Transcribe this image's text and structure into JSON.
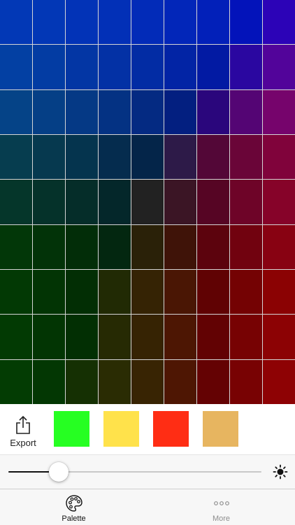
{
  "palette": {
    "rows": [
      [
        "#0238b6",
        "#0237b6",
        "#0233b7",
        "#0230b7",
        "#022bb8",
        "#0226b9",
        "#0220b9",
        "#0313ba",
        "#2c03b7"
      ],
      [
        "#0340a3",
        "#033ca3",
        "#0336a4",
        "#0331a5",
        "#022ca4",
        "#0224a5",
        "#021aa3",
        "#2a07a0",
        "#52049a"
      ],
      [
        "#054387",
        "#053f86",
        "#053985",
        "#043283",
        "#042a82",
        "#031f80",
        "#2a067c",
        "#540574",
        "#76046c"
      ],
      [
        "#063d4f",
        "#06394f",
        "#05344e",
        "#052c4e",
        "#042549",
        "#2d1a48",
        "#530737",
        "#6a0538",
        "#80033b"
      ],
      [
        "#05362a",
        "#05322a",
        "#052d29",
        "#04272a",
        "#222222",
        "#3b1525",
        "#560524",
        "#6e0428",
        "#860329"
      ],
      [
        "#023708",
        "#023308",
        "#022d08",
        "#032710",
        "#2a2108",
        "#3f1308",
        "#5c030d",
        "#71020f",
        "#880212"
      ],
      [
        "#023904",
        "#023404",
        "#022e04",
        "#212a04",
        "#352304",
        "#4a1604",
        "#600203",
        "#740203",
        "#8b0203"
      ],
      [
        "#023a03",
        "#023503",
        "#022f03",
        "#262a03",
        "#362303",
        "#4d1603",
        "#620203",
        "#770203",
        "#8c0204"
      ],
      [
        "#033c03",
        "#033703",
        "#153003",
        "#2a2c03",
        "#382403",
        "#4e1603",
        "#640203",
        "#780203",
        "#8e0204"
      ]
    ]
  },
  "toolbar": {
    "export_label": "Export",
    "export_icon": "share-icon",
    "swatches": [
      "#26ff22",
      "#ffe24b",
      "#ff2d14",
      "#e7b560"
    ]
  },
  "brightness": {
    "value_fraction": 0.2,
    "icon": "sun-icon"
  },
  "tabs": [
    {
      "label": "Palette",
      "icon": "palette-icon",
      "active": true
    },
    {
      "label": "More",
      "icon": "more-icon",
      "active": false
    }
  ]
}
